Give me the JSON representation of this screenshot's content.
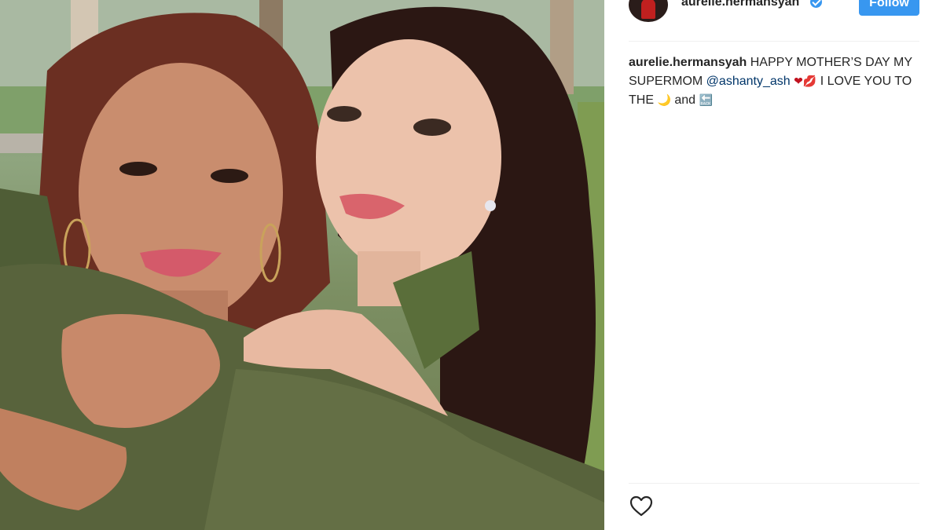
{
  "post": {
    "username": "aurelie.hermansyah",
    "follow_label": "Follow"
  },
  "caption": {
    "username": "aurelie.hermansyah",
    "text_part1": " HAPPY MOTHER’S DAY MY SUPERMOM ",
    "mention": "@ashanty_ash",
    "emoji_heart": "❤",
    "emoji_kiss": "💋",
    "text_part2": " I LOVE YOU TO THE ",
    "emoji_moon": "🌙",
    "text_part3": " and ",
    "emoji_back": "🔙"
  },
  "icons": {
    "verified": "verified-badge-icon",
    "like": "heart-outline-icon"
  },
  "colors": {
    "accent": "#3897f0",
    "text": "#262626",
    "mention": "#003569",
    "divider": "#efefef"
  }
}
